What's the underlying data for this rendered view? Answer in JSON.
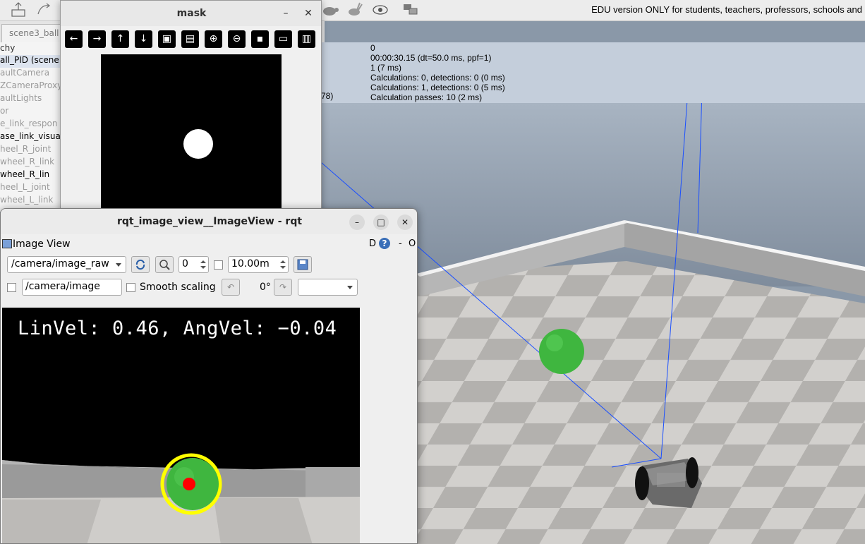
{
  "sim": {
    "edu_notice": "EDU version ONLY for students, teachers, professors, schools and",
    "scene_tab": "scene3_ball",
    "hierarchy_title": "chy",
    "hierarchy": [
      {
        "label": "all_PID (scene",
        "style": "dark"
      },
      {
        "label": "aultCamera",
        "style": "dim"
      },
      {
        "label": "ZCameraProxy",
        "style": "dim"
      },
      {
        "label": "aultLights",
        "style": "dim"
      },
      {
        "label": "or",
        "style": "dim"
      },
      {
        "label": "e_link_respon",
        "style": "dim"
      },
      {
        "label": "ase_link_visua",
        "style": "dark"
      },
      {
        "label": "heel_R_joint",
        "style": "dim"
      },
      {
        "label": "wheel_R_link",
        "style": "dim"
      },
      {
        "label": "wheel_R_lin",
        "style": "dark"
      },
      {
        "label": "heel_L_joint",
        "style": "dim"
      },
      {
        "label": "wheel_L_link",
        "style": "dim"
      }
    ],
    "info": [
      "0",
      "00:00:30.15 (dt=50.0 ms, ppf=1)",
      "1 (7 ms)",
      "Calculations: 0, detections: 0 (0 ms)",
      "Calculations: 1, detections: 0 (5 ms)",
      "Calculation passes: 10 (2 ms)"
    ],
    "info_partial": "78)"
  },
  "mask_window": {
    "title": "mask",
    "minimize": "–",
    "close": "✕",
    "tools": [
      {
        "name": "back-arrow-icon",
        "glyph": "←"
      },
      {
        "name": "forward-arrow-icon",
        "glyph": "→"
      },
      {
        "name": "up-arrow-icon",
        "glyph": "↑"
      },
      {
        "name": "down-arrow-icon",
        "glyph": "↓"
      },
      {
        "name": "image-icon",
        "glyph": "▣"
      },
      {
        "name": "image-edit-icon",
        "glyph": "▤"
      },
      {
        "name": "zoom-in-icon",
        "glyph": "⊕"
      },
      {
        "name": "zoom-out-icon",
        "glyph": "⊖"
      },
      {
        "name": "save-icon",
        "glyph": "▪"
      },
      {
        "name": "clipboard-icon",
        "glyph": "▭"
      },
      {
        "name": "paint-icon",
        "glyph": "▥"
      }
    ]
  },
  "rqt": {
    "title": "rqt_image_view__ImageView - rqt",
    "plugin_title": "Image View",
    "plugin_d": "D",
    "plugin_help": "?",
    "plugin_dash": "-",
    "plugin_o": "O",
    "topic": "/camera/image_raw",
    "zoom_value": "0",
    "duration_value": "10.00m",
    "publish_topic": "/camera/image",
    "smooth_scaling": "Smooth scaling",
    "rotation": "0°",
    "rotation_select": "",
    "overlay_text": "LinVel: 0.46, AngVel: −0.04",
    "window_buttons": {
      "minimize": "–",
      "maximize": "□",
      "close": "✕"
    }
  },
  "colors": {
    "ball_green": "#3fb63f",
    "detect_ring": "#ffff00",
    "centroid": "#ff0000",
    "sky": "#8a98a8",
    "laser": "#1a4fff"
  }
}
